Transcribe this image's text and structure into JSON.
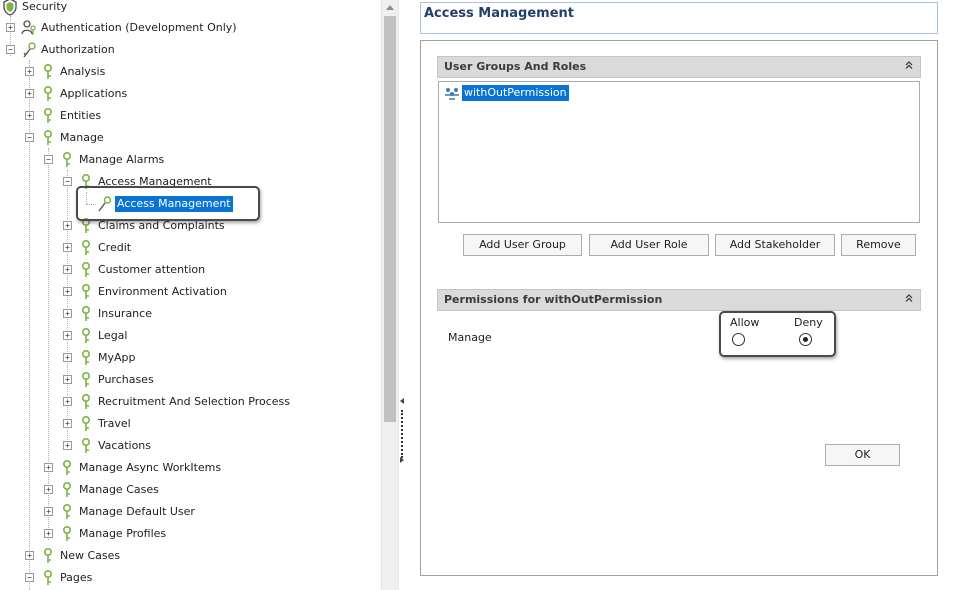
{
  "colors": {
    "selection": "#0a74d4",
    "title": "#243f6c",
    "icon_green": "#7cb342"
  },
  "tree": {
    "root": "Security",
    "authentication": "Authentication (Development Only)",
    "authorization": "Authorization",
    "analysis": "Analysis",
    "applications": "Applications",
    "entities": "Entities",
    "manage": "Manage",
    "manage_alarms": "Manage Alarms",
    "access_management_folder": "Access Management",
    "access_management_selected": "Access Management",
    "alarms": [
      "Claims and Complaints",
      "Credit",
      "Customer attention",
      "Environment Activation",
      "Insurance",
      "Legal",
      "MyApp",
      "Purchases",
      "Recruitment And Selection Process",
      "Travel",
      "Vacations"
    ],
    "manage_items": [
      "Manage Async WorkItems",
      "Manage Cases",
      "Manage Default User",
      "Manage Profiles"
    ],
    "new_cases": "New Cases",
    "pages": "Pages"
  },
  "panel": {
    "title": "Access Management",
    "groups_header": "User Groups And Roles",
    "group_item": "withOutPermission",
    "buttons": {
      "add_user_group": "Add User Group",
      "add_user_role": "Add User Role",
      "add_stakeholder": "Add Stakeholder",
      "remove": "Remove",
      "ok": "OK"
    },
    "permissions_header": "Permissions for withOutPermission",
    "permission_name": "Manage",
    "allow_label": "Allow",
    "deny_label": "Deny",
    "selected_option": "Deny"
  }
}
